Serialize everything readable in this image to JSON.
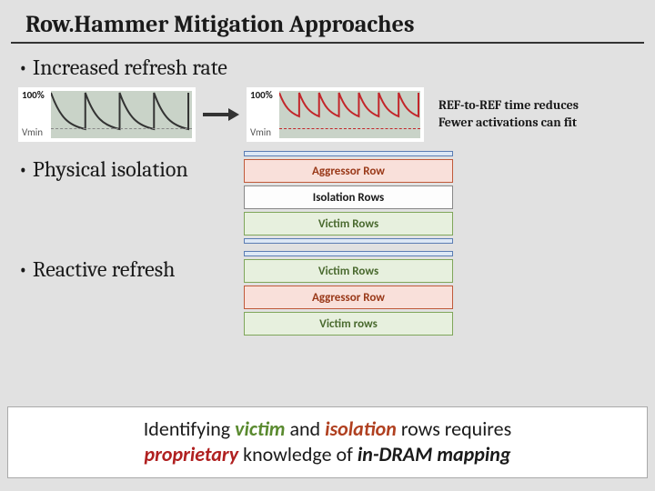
{
  "title": "Row.Hammer Mitigation Approaches",
  "bullets": {
    "refresh": "• Increased refresh rate",
    "isolation": "• Physical isolation",
    "reactive": "• Reactive refresh"
  },
  "chart": {
    "label100": "100%",
    "labelVmin": "Vmin"
  },
  "refText": {
    "line1": "REF-to-REF time reduces",
    "line2": "Fewer activations can fit"
  },
  "isoStack": {
    "aggressor": "Aggressor Row",
    "isolation": "Isolation Rows",
    "victim": "Victim Rows"
  },
  "reactiveStack": {
    "victimTop": "Victim Rows",
    "aggressor": "Aggressor Row",
    "victimBot": "Victim rows"
  },
  "footer": {
    "t1": "Identifying ",
    "victim": "victim",
    "t2": " and ",
    "isolation": "isolation",
    "t3": " rows requires",
    "proprietary": "proprietary",
    "t4": " knowledge of ",
    "dram": "in-DRAM mapping"
  }
}
